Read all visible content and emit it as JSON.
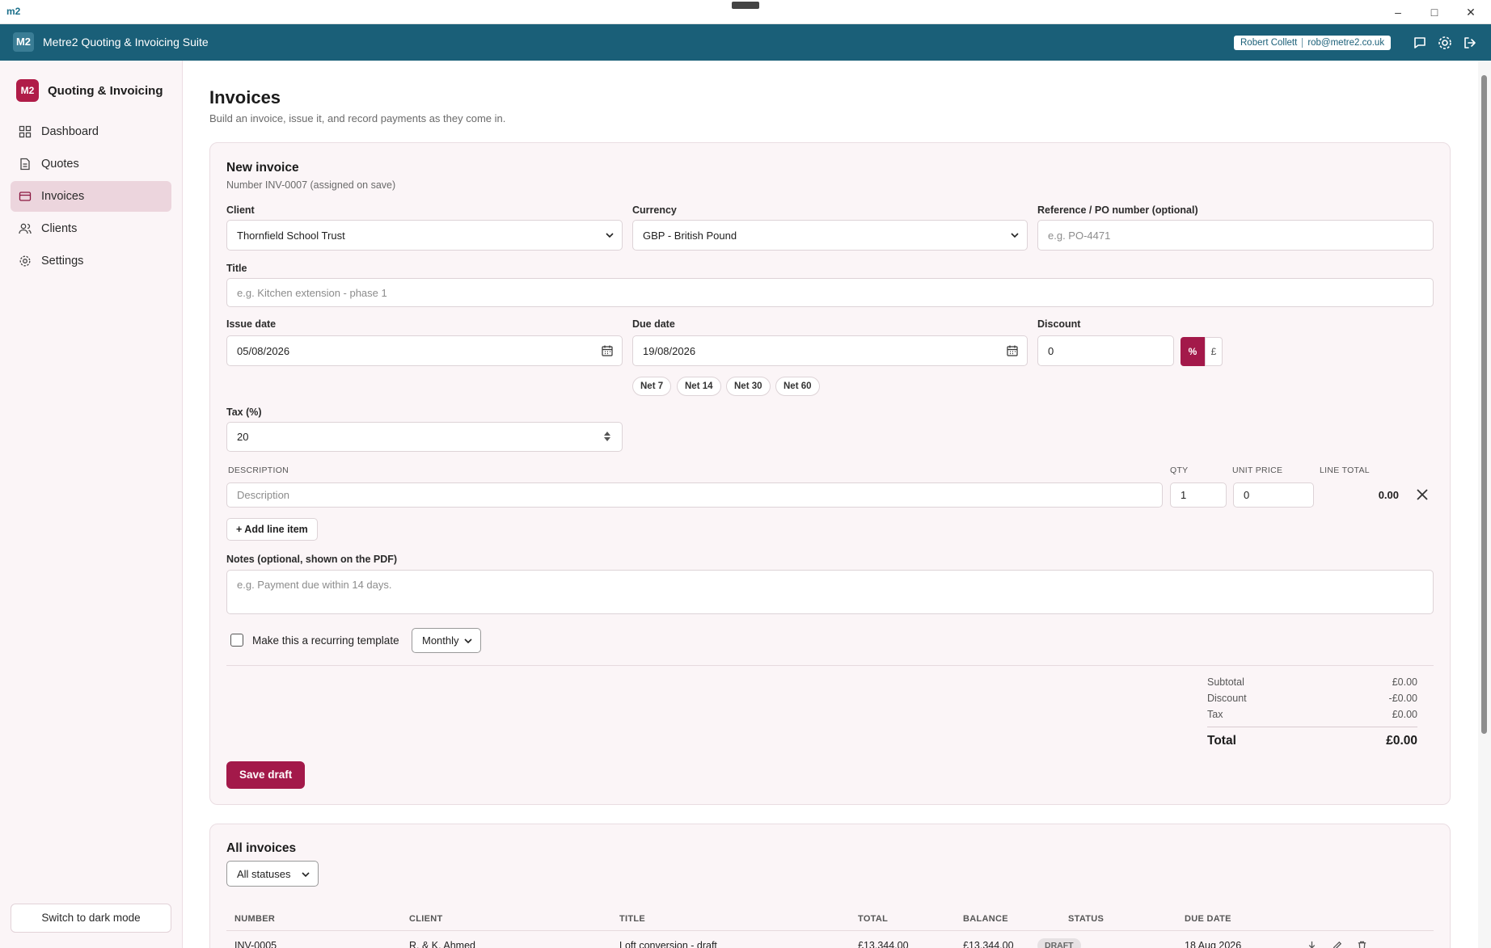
{
  "window": {
    "logo": "m2"
  },
  "header": {
    "badge": "M2",
    "title": "Metre2 Quoting & Invoicing Suite",
    "user_name": "Robert Collett",
    "user_email": "rob@metre2.co.uk"
  },
  "sidebar": {
    "brand_badge": "M2",
    "brand_name": "Quoting & Invoicing",
    "items": [
      {
        "label": "Dashboard",
        "icon": "dashboard-icon"
      },
      {
        "label": "Quotes",
        "icon": "document-icon"
      },
      {
        "label": "Invoices",
        "icon": "card-icon",
        "active": true
      },
      {
        "label": "Clients",
        "icon": "users-icon"
      },
      {
        "label": "Settings",
        "icon": "gear-icon"
      }
    ],
    "dark_mode_label": "Switch to dark mode"
  },
  "page": {
    "title": "Invoices",
    "subtitle": "Build an invoice, issue it, and record payments as they come in."
  },
  "new_invoice": {
    "title": "New invoice",
    "number_note": "Number INV-0007 (assigned on save)",
    "client_label": "Client",
    "client_value": "Thornfield School Trust",
    "currency_label": "Currency",
    "currency_value": "GBP - British Pound",
    "reference_label": "Reference / PO number (optional)",
    "reference_placeholder": "e.g. PO-4471",
    "title_label": "Title",
    "title_placeholder": "e.g. Kitchen extension - phase 1",
    "issue_date_label": "Issue date",
    "issue_date_value": "05/08/2026",
    "due_date_label": "Due date",
    "due_date_value": "19/08/2026",
    "discount_label": "Discount",
    "discount_value": "0",
    "discount_pct": "%",
    "discount_gbp": "£",
    "net_terms": [
      "Net 7",
      "Net 14",
      "Net 30",
      "Net 60"
    ],
    "tax_label": "Tax (%)",
    "tax_value": "20",
    "line_headers": {
      "description": "DESCRIPTION",
      "qty": "QTY",
      "unit_price": "UNIT PRICE",
      "line_total": "LINE TOTAL"
    },
    "line_item": {
      "description_placeholder": "Description",
      "qty": "1",
      "unit_price": "0",
      "total": "0.00"
    },
    "add_line_label": "+ Add line item",
    "notes_label": "Notes (optional, shown on the PDF)",
    "notes_placeholder": "e.g. Payment due within 14 days.",
    "recurring_label": "Make this a recurring template",
    "recurring_frequency": "Monthly",
    "summary": {
      "subtotal_label": "Subtotal",
      "subtotal": "£0.00",
      "discount_label": "Discount",
      "discount": "-£0.00",
      "tax_label": "Tax",
      "tax": "£0.00",
      "total_label": "Total",
      "total": "£0.00"
    },
    "save_label": "Save draft"
  },
  "all_invoices": {
    "title": "All invoices",
    "status_filter": "All statuses",
    "columns": [
      "NUMBER",
      "CLIENT",
      "TITLE",
      "TOTAL",
      "BALANCE",
      "STATUS",
      "DUE DATE"
    ],
    "rows": [
      {
        "number": "INV-0005",
        "client": "R. & K. Ahmed",
        "title": "Loft conversion - draft",
        "total": "£13,344.00",
        "balance": "£13,344.00",
        "status": "DRAFT",
        "due_date": "18 Aug 2026"
      }
    ]
  },
  "colors": {
    "header": "#1a5f78",
    "accent": "#a3194a",
    "sidebar_bg": "#fbf5f7",
    "active_nav": "#ecd5dd"
  }
}
